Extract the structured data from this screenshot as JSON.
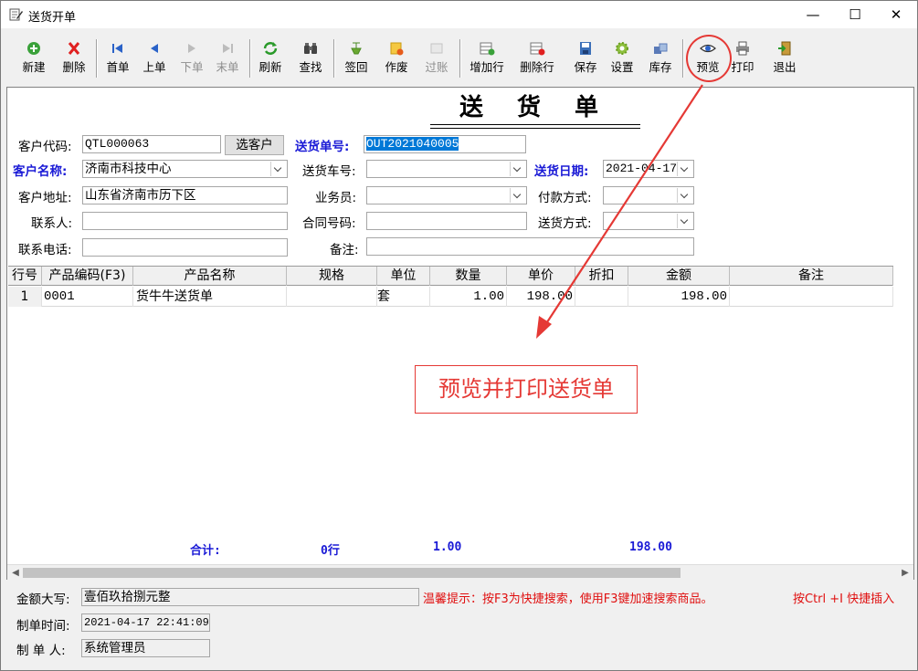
{
  "window": {
    "title": "送货开单",
    "minimize": "—",
    "maximize": "☐",
    "close": "✕"
  },
  "toolbar": {
    "new": "新建",
    "delete": "删除",
    "first": "首单",
    "prev": "上单",
    "next": "下单",
    "last": "末单",
    "refresh": "刷新",
    "find": "查找",
    "sign_back": "签回",
    "void": "作废",
    "post": "过账",
    "add_row": "增加行",
    "delete_row": "删除行",
    "save": "保存",
    "settings": "设置",
    "stock": "库存",
    "preview": "预览",
    "print": "打印",
    "exit": "退出"
  },
  "document": {
    "title": "送 货 单"
  },
  "form": {
    "customer_code_label": "客户代码:",
    "customer_code": "QTL000063",
    "select_customer": "选客户",
    "order_no_label": "送货单号:",
    "order_no": "OUT2021040005",
    "customer_name_label": "客户名称:",
    "customer_name": "济南市科技中心",
    "vehicle_label": "送货车号:",
    "vehicle": "",
    "delivery_date_label": "送货日期:",
    "delivery_date": "2021-04-17",
    "address_label": "客户地址:",
    "address": "山东省济南市历下区",
    "salesman_label": "业务员:",
    "salesman": "",
    "payment_label": "付款方式:",
    "payment": "",
    "contact_label": "联系人:",
    "contact": "",
    "contract_label": "合同号码:",
    "contract": "",
    "delivery_method_label": "送货方式:",
    "delivery_method": "",
    "phone_label": "联系电话:",
    "phone": "",
    "remark_label": "备注:",
    "remark": ""
  },
  "grid": {
    "columns": [
      "行号",
      "产品编码(F3)",
      "产品名称",
      "规格",
      "单位",
      "数量",
      "单价",
      "折扣",
      "金额",
      "备注"
    ],
    "rows": [
      {
        "no": "1",
        "code": "0001",
        "name": "货牛牛送货单",
        "spec": "",
        "unit": "套",
        "qty": "1.00",
        "price": "198.00",
        "discount": "",
        "amount": "198.00",
        "remark": ""
      }
    ],
    "totals": {
      "label": "合计:",
      "rows": "0行",
      "qty": "1.00",
      "amount": "198.00"
    }
  },
  "annotation": {
    "callout": "预览并打印送货单",
    "color": "#e53935"
  },
  "footer": {
    "amount_words_label": "金额大写:",
    "amount_words": "壹佰玖拾捌元整",
    "created_time_label": "制单时间:",
    "created_time": "2021-04-17 22:41:09",
    "creator_label": "制 单 人:",
    "creator": "系统管理员",
    "hint1": "温馨提示：按F3为快捷搜索，使用F3键加速搜索商品。",
    "hint2": "按Ctrl +I 快捷插入"
  },
  "colors": {
    "label_blue": "#1a1ad6",
    "hint_red": "#e01010",
    "selection": "#0078d7"
  }
}
